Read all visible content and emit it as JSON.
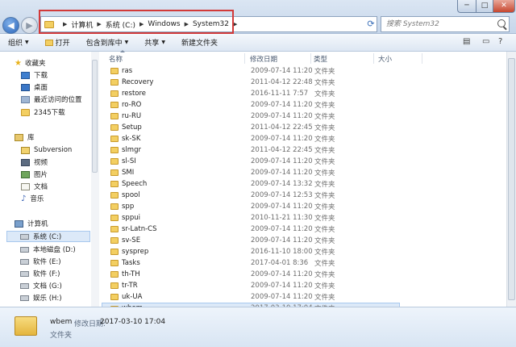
{
  "window": {
    "minimize": "─",
    "maximize": "□",
    "close": "✕"
  },
  "nav_buttons": {
    "back": "◀",
    "forward": "▶"
  },
  "address": {
    "crumbs": [
      "计算机",
      "系统 (C:)",
      "Windows",
      "System32"
    ],
    "highlight_color": "#d23a3a"
  },
  "search": {
    "placeholder": "搜索 System32"
  },
  "toolbar": {
    "organize": "组织",
    "open": "打开",
    "include_in_library": "包含到库中",
    "share": "共享",
    "new_folder": "新建文件夹"
  },
  "nav": {
    "favorites": "收藏夹",
    "downloads": "下载",
    "desktop": "桌面",
    "recent": "最近访问的位置",
    "downloads2345": "2345下载",
    "libraries": "库",
    "subversion": "Subversion",
    "videos": "视频",
    "pictures": "图片",
    "documents": "文档",
    "music": "音乐",
    "computer": "计算机",
    "drives": [
      "系统 (C:)",
      "本地磁盘 (D:)",
      "软件 (E:)",
      "软件 (F:)",
      "文档 (G:)",
      "娱乐 (H:)"
    ]
  },
  "columns": {
    "name": "名称",
    "date": "修改日期",
    "type": "类型",
    "size": "大小"
  },
  "rows": [
    {
      "name": "ras",
      "date": "2009-07-14 11:20",
      "type": "文件夹"
    },
    {
      "name": "Recovery",
      "date": "2011-04-12 22:48",
      "type": "文件夹"
    },
    {
      "name": "restore",
      "date": "2016-11-11 7:57",
      "type": "文件夹"
    },
    {
      "name": "ro-RO",
      "date": "2009-07-14 11:20",
      "type": "文件夹"
    },
    {
      "name": "ru-RU",
      "date": "2009-07-14 11:20",
      "type": "文件夹"
    },
    {
      "name": "Setup",
      "date": "2011-04-12 22:45",
      "type": "文件夹"
    },
    {
      "name": "sk-SK",
      "date": "2009-07-14 11:20",
      "type": "文件夹"
    },
    {
      "name": "slmgr",
      "date": "2011-04-12 22:45",
      "type": "文件夹"
    },
    {
      "name": "sl-SI",
      "date": "2009-07-14 11:20",
      "type": "文件夹"
    },
    {
      "name": "SMI",
      "date": "2009-07-14 11:20",
      "type": "文件夹"
    },
    {
      "name": "Speech",
      "date": "2009-07-14 13:32",
      "type": "文件夹"
    },
    {
      "name": "spool",
      "date": "2009-07-14 12:53",
      "type": "文件夹"
    },
    {
      "name": "spp",
      "date": "2009-07-14 11:20",
      "type": "文件夹"
    },
    {
      "name": "sppui",
      "date": "2010-11-21 11:30",
      "type": "文件夹"
    },
    {
      "name": "sr-Latn-CS",
      "date": "2009-07-14 11:20",
      "type": "文件夹"
    },
    {
      "name": "sv-SE",
      "date": "2009-07-14 11:20",
      "type": "文件夹"
    },
    {
      "name": "sysprep",
      "date": "2016-11-10 18:00",
      "type": "文件夹"
    },
    {
      "name": "Tasks",
      "date": "2017-04-01 8:36",
      "type": "文件夹"
    },
    {
      "name": "th-TH",
      "date": "2009-07-14 11:20",
      "type": "文件夹"
    },
    {
      "name": "tr-TR",
      "date": "2009-07-14 11:20",
      "type": "文件夹"
    },
    {
      "name": "uk-UA",
      "date": "2009-07-14 11:20",
      "type": "文件夹"
    },
    {
      "name": "wbem",
      "date": "2017-03-10 17:04",
      "type": "文件夹"
    }
  ],
  "selected_index": 21,
  "details": {
    "name": "wbem",
    "date_label": "修改日期:",
    "date": "2017-03-10 17:04",
    "type": "文件夹"
  },
  "colors": {
    "selection_bg": "#dce9f8",
    "folder": "#f3cf62"
  }
}
